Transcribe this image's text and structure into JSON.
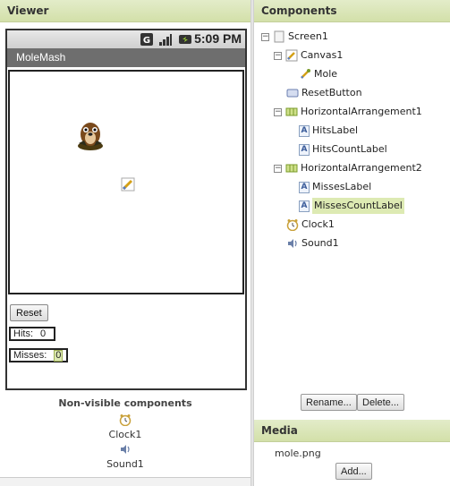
{
  "viewer": {
    "title": "Viewer",
    "status_time": "5:09 PM",
    "app_title": "MoleMash",
    "reset_label": "Reset",
    "hits_label": "Hits:",
    "hits_count": "0",
    "misses_label": "Misses:",
    "misses_count": "0",
    "nonvisible_title": "Non-visible components",
    "nonvisible": [
      {
        "label": "Clock1",
        "icon": "clock-icon"
      },
      {
        "label": "Sound1",
        "icon": "sound-icon"
      }
    ]
  },
  "components": {
    "title": "Components",
    "tree": [
      {
        "label": "Screen1",
        "icon": "screen-icon"
      },
      {
        "label": "Canvas1",
        "icon": "canvas-icon"
      },
      {
        "label": "Mole",
        "icon": "image-sprite-icon"
      },
      {
        "label": "ResetButton",
        "icon": "button-icon"
      },
      {
        "label": "HorizontalArrangement1",
        "icon": "arrangement-icon"
      },
      {
        "label": "HitsLabel",
        "icon": "label-icon"
      },
      {
        "label": "HitsCountLabel",
        "icon": "label-icon"
      },
      {
        "label": "HorizontalArrangement2",
        "icon": "arrangement-icon"
      },
      {
        "label": "MissesLabel",
        "icon": "label-icon"
      },
      {
        "label": "MissesCountLabel",
        "icon": "label-icon",
        "selected": true
      },
      {
        "label": "Clock1",
        "icon": "clock-icon"
      },
      {
        "label": "Sound1",
        "icon": "sound-icon"
      }
    ],
    "rename_label": "Rename...",
    "delete_label": "Delete..."
  },
  "media": {
    "title": "Media",
    "files": [
      "mole.png"
    ],
    "add_label": "Add..."
  },
  "colors": {
    "header_bg": "#d8e4b0",
    "selection": "#ddeab3",
    "titlebar": "#6e6e6e"
  }
}
